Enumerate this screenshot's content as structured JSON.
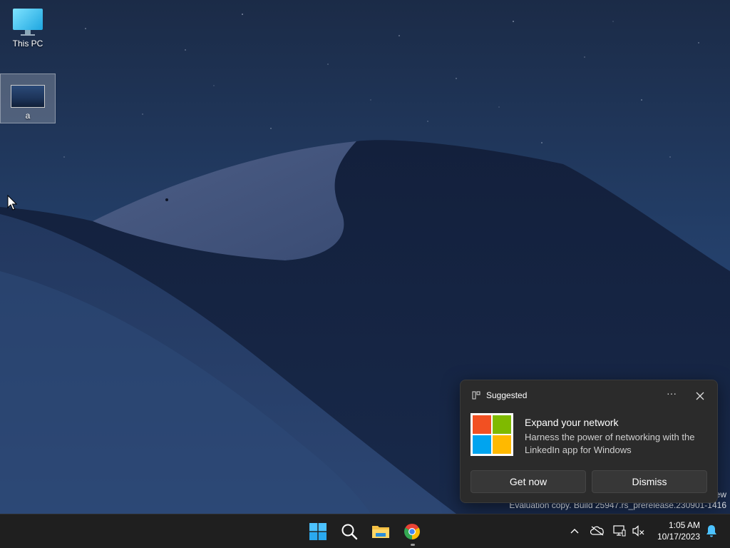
{
  "desktop": {
    "icons": [
      {
        "label": "This PC",
        "icon": "monitor-icon"
      },
      {
        "label": "a",
        "icon": "image-thumbnail-icon"
      }
    ]
  },
  "watermark": {
    "line1": "ew",
    "line2": "Evaluation copy. Build 25947.rs_prerelease.230901-1416"
  },
  "toast": {
    "header": "Suggested",
    "header_icon": "widgets-icon",
    "more_icon": "more-options-icon",
    "close_icon": "close-icon",
    "logo": "microsoft-logo-icon",
    "title": "Expand your network",
    "body": "Harness the power of networking with the LinkedIn app for Windows",
    "primary_button": "Get now",
    "secondary_button": "Dismiss",
    "logo_colors": [
      "#f25022",
      "#7fba00",
      "#00a4ef",
      "#ffb900"
    ]
  },
  "taskbar": {
    "apps": [
      {
        "name": "Start",
        "icon": "windows-start-icon"
      },
      {
        "name": "Search",
        "icon": "search-icon"
      },
      {
        "name": "File Explorer",
        "icon": "folder-icon"
      },
      {
        "name": "Google Chrome",
        "icon": "chrome-icon"
      }
    ],
    "tray": {
      "time": "1:05 AM",
      "date": "10/17/2023",
      "icons": [
        "chevron-up-icon",
        "onedrive-icon",
        "network-icon",
        "volume-muted-icon",
        "notification-bell-icon"
      ]
    }
  },
  "colors": {
    "taskbar": "#1f1f1f",
    "toast_bg": "#2b2b2b",
    "accent": "#4cc2ff"
  }
}
